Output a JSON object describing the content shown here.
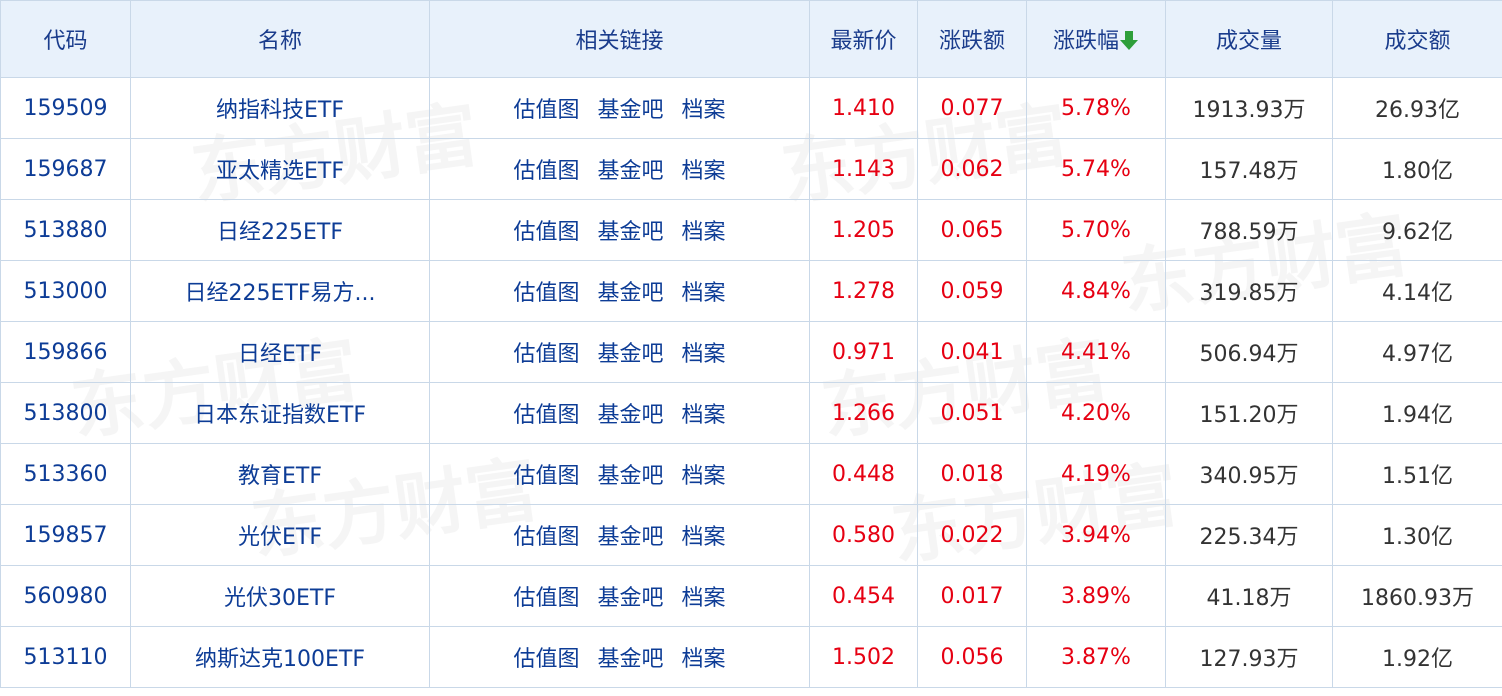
{
  "header": {
    "code": "代码",
    "name": "名称",
    "links": "相关链接",
    "price": "最新价",
    "change": "涨跌额",
    "change_pct": "涨跌幅",
    "volume": "成交量",
    "amount": "成交额"
  },
  "sort_icon": "arrow-down-icon",
  "colors": {
    "header_bg": "#e8f1fb",
    "border": "#c9d8e8",
    "link_blue": "#0d3c96",
    "up_red": "#e60012",
    "sort_green": "#2e9f3a"
  },
  "watermark": "东方财富",
  "rows": [
    {
      "code": "159509",
      "name": "纳指科技ETF",
      "links": [
        "估值图",
        "基金吧",
        "档案"
      ],
      "price": "1.410",
      "change": "0.077",
      "change_pct": "5.78%",
      "volume": "1913.93万",
      "amount": "26.93亿"
    },
    {
      "code": "159687",
      "name": "亚太精选ETF",
      "links": [
        "估值图",
        "基金吧",
        "档案"
      ],
      "price": "1.143",
      "change": "0.062",
      "change_pct": "5.74%",
      "volume": "157.48万",
      "amount": "1.80亿"
    },
    {
      "code": "513880",
      "name": "日经225ETF",
      "links": [
        "估值图",
        "基金吧",
        "档案"
      ],
      "price": "1.205",
      "change": "0.065",
      "change_pct": "5.70%",
      "volume": "788.59万",
      "amount": "9.62亿"
    },
    {
      "code": "513000",
      "name": "日经225ETF易方...",
      "links": [
        "估值图",
        "基金吧",
        "档案"
      ],
      "price": "1.278",
      "change": "0.059",
      "change_pct": "4.84%",
      "volume": "319.85万",
      "amount": "4.14亿"
    },
    {
      "code": "159866",
      "name": "日经ETF",
      "links": [
        "估值图",
        "基金吧",
        "档案"
      ],
      "price": "0.971",
      "change": "0.041",
      "change_pct": "4.41%",
      "volume": "506.94万",
      "amount": "4.97亿"
    },
    {
      "code": "513800",
      "name": "日本东证指数ETF",
      "links": [
        "估值图",
        "基金吧",
        "档案"
      ],
      "price": "1.266",
      "change": "0.051",
      "change_pct": "4.20%",
      "volume": "151.20万",
      "amount": "1.94亿"
    },
    {
      "code": "513360",
      "name": "教育ETF",
      "links": [
        "估值图",
        "基金吧",
        "档案"
      ],
      "price": "0.448",
      "change": "0.018",
      "change_pct": "4.19%",
      "volume": "340.95万",
      "amount": "1.51亿"
    },
    {
      "code": "159857",
      "name": "光伏ETF",
      "links": [
        "估值图",
        "基金吧",
        "档案"
      ],
      "price": "0.580",
      "change": "0.022",
      "change_pct": "3.94%",
      "volume": "225.34万",
      "amount": "1.30亿"
    },
    {
      "code": "560980",
      "name": "光伏30ETF",
      "links": [
        "估值图",
        "基金吧",
        "档案"
      ],
      "price": "0.454",
      "change": "0.017",
      "change_pct": "3.89%",
      "volume": "41.18万",
      "amount": "1860.93万"
    },
    {
      "code": "513110",
      "name": "纳斯达克100ETF",
      "links": [
        "估值图",
        "基金吧",
        "档案"
      ],
      "price": "1.502",
      "change": "0.056",
      "change_pct": "3.87%",
      "volume": "127.93万",
      "amount": "1.92亿"
    }
  ]
}
